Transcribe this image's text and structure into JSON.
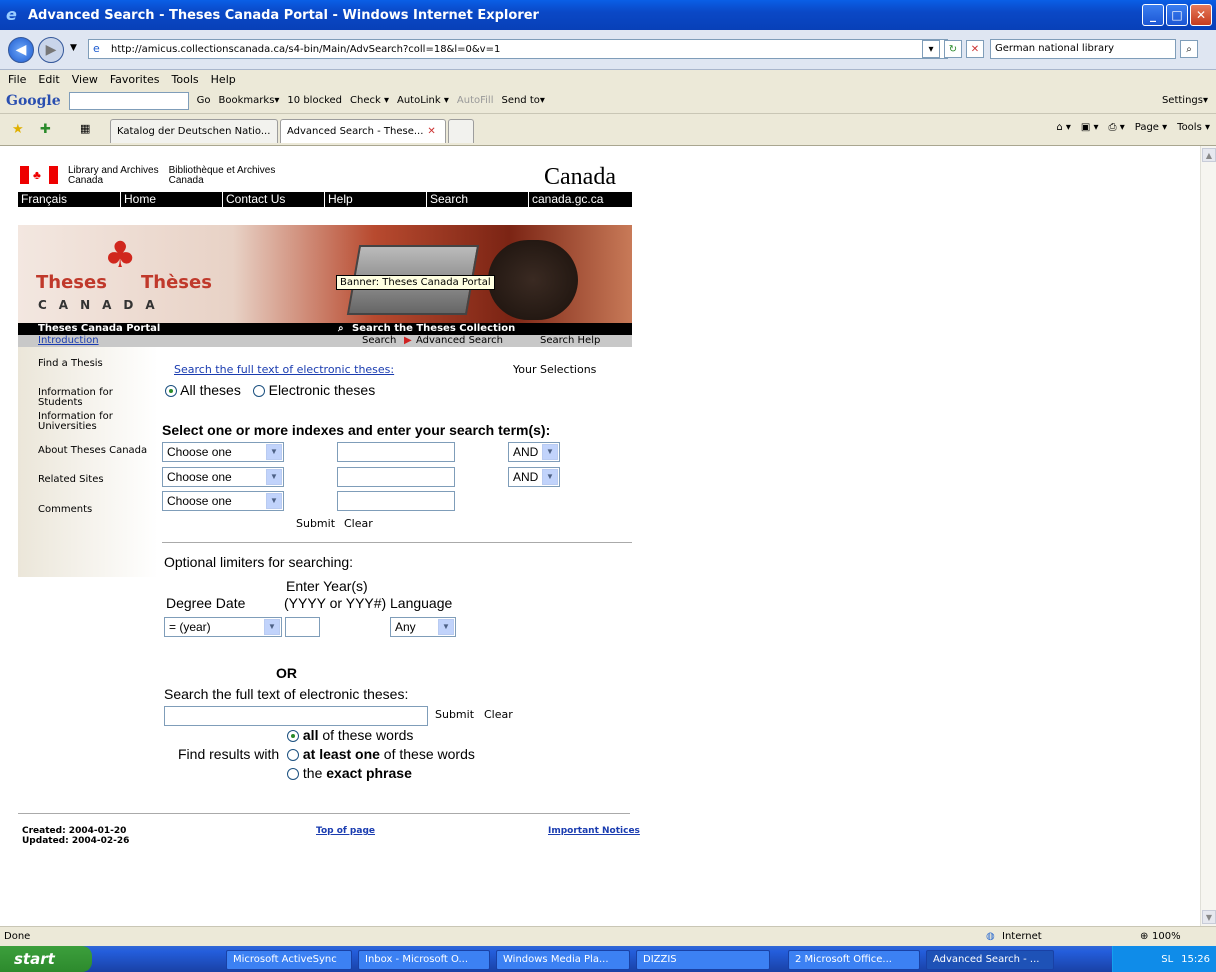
{
  "window": {
    "title": "Advanced Search - Theses Canada Portal - Windows Internet Explorer"
  },
  "address": {
    "url": "http://amicus.collectionscanada.ca/s4-bin/Main/AdvSearch?coll=18&l=0&v=1",
    "search_value": "German national library"
  },
  "menu": [
    "File",
    "Edit",
    "View",
    "Favorites",
    "Tools",
    "Help"
  ],
  "googlebar": {
    "logo": "Google",
    "go": "Go",
    "bookmarks": "Bookmarks▾",
    "blocked": "10 blocked",
    "check": "Check ▾",
    "autolink": "AutoLink ▾",
    "autofill": "AutoFill",
    "sendto": "Send to▾",
    "settings": "Settings▾"
  },
  "tabs": [
    {
      "label": "Katalog der Deutschen Natio..."
    },
    {
      "label": "Advanced Search - These..."
    }
  ],
  "tabtools": {
    "page": "Page ▾",
    "tools": "Tools ▾"
  },
  "header": {
    "lac_en": "Library and Archives",
    "lac_en2": "Canada",
    "lac_fr": "Bibliothèque et Archives",
    "lac_fr2": "Canada",
    "wordmark": "Canada"
  },
  "fednav": [
    "Français",
    "Home",
    "Contact Us",
    "Help",
    "Search",
    "canada.gc.ca"
  ],
  "banner": {
    "theses": "Theses",
    "theses_fr": "Thèses",
    "canada": "CANADA",
    "tooltip": "Banner: Theses Canada Portal"
  },
  "darkbar": {
    "left": "Theses Canada Portal",
    "right": "Search the Theses Collection"
  },
  "greybar": {
    "intro": "Introduction",
    "search": "Search",
    "advanced": "Advanced Search",
    "help": "Search Help"
  },
  "leftnav": [
    "Find a Thesis",
    "Information for Students",
    "Information for",
    "Universities",
    "About Theses Canada",
    "Related Sites",
    "Comments"
  ],
  "form": {
    "fulltext_link": "Search the full text of electronic theses:",
    "your_selections": "Your Selections",
    "radio_all": "All theses",
    "radio_electronic": "Electronic theses",
    "heading": "Select one or more indexes and enter your search term(s):",
    "choose": "Choose one",
    "and": "AND",
    "submit": "Submit",
    "clear": "Clear",
    "limiters": "Optional limiters for searching:",
    "enter_year": "Enter Year(s)",
    "degree_date": "Degree Date",
    "year_format": "(YYYY or YYY#)",
    "language": "Language",
    "year_select": "= (year)",
    "lang_select": "Any",
    "or": "OR",
    "fulltext2": "Search the full text of electronic theses:",
    "find_results": "Find results with",
    "opt_all_b": "all",
    "opt_all": " of these words",
    "opt_one_b": "at least one",
    "opt_one": " of these words",
    "opt_exact_pre": "the ",
    "opt_exact_b": "exact phrase"
  },
  "footer": {
    "created": "Created: 2004-01-20",
    "updated": "Updated: 2004-02-26",
    "top": "Top of page",
    "notices": "Important Notices"
  },
  "status": {
    "text": "Done",
    "zone": "Internet",
    "zoom": "100%"
  },
  "taskbar": {
    "start": "start",
    "items": [
      "Microsoft ActiveSync",
      "Inbox - Microsoft O...",
      "Windows Media Pla...",
      "DIZZIS",
      "2 Microsoft Office...",
      "Advanced Search - ..."
    ],
    "lang": "SL",
    "time": "15:26"
  }
}
